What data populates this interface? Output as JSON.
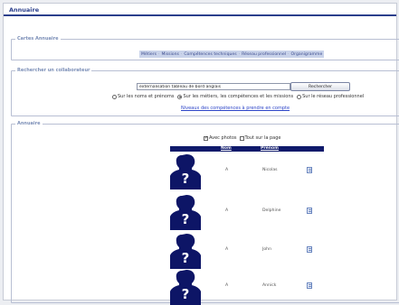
{
  "title": "Annuaire",
  "cartes": {
    "legend": "Cartes Annuaire",
    "tabs": [
      "Métiers",
      "Missions",
      "Compétences techniques",
      "Réseau professionnel",
      "Organigramme"
    ]
  },
  "search": {
    "legend": "Rechercher un collaborateur",
    "query": "externalisation tableau de bord anglais",
    "button": "Rechercher",
    "radios": [
      {
        "label": "Sur les noms et prénoms",
        "checked": false
      },
      {
        "label": "Sur les métiers, les compétences et les missions",
        "checked": true
      },
      {
        "label": "Sur le réseau professionnel",
        "checked": false
      }
    ],
    "link": "Niveaux des compétences à prendre en compte"
  },
  "annuaire": {
    "legend": "Annuaire",
    "with_photos": {
      "label": "Avec photos",
      "checked": true
    },
    "all_on_page": {
      "label": "Tout sur la page",
      "checked": false
    },
    "headers": {
      "nom": "Nom",
      "prenom": "Prénom"
    },
    "rows": [
      {
        "nom": "A",
        "prenom": "Nicolas"
      },
      {
        "nom": "A",
        "prenom": "Delphine"
      },
      {
        "nom": "A",
        "prenom": "John"
      },
      {
        "nom": "A",
        "prenom": "Annick"
      }
    ]
  },
  "colors": {
    "header_bar": "#0f1a6b",
    "avatar": "#0d1566",
    "accent": "#2b3f8c"
  },
  "icons": {
    "avatar": "person-placeholder-icon",
    "row_action": "document-icon"
  }
}
